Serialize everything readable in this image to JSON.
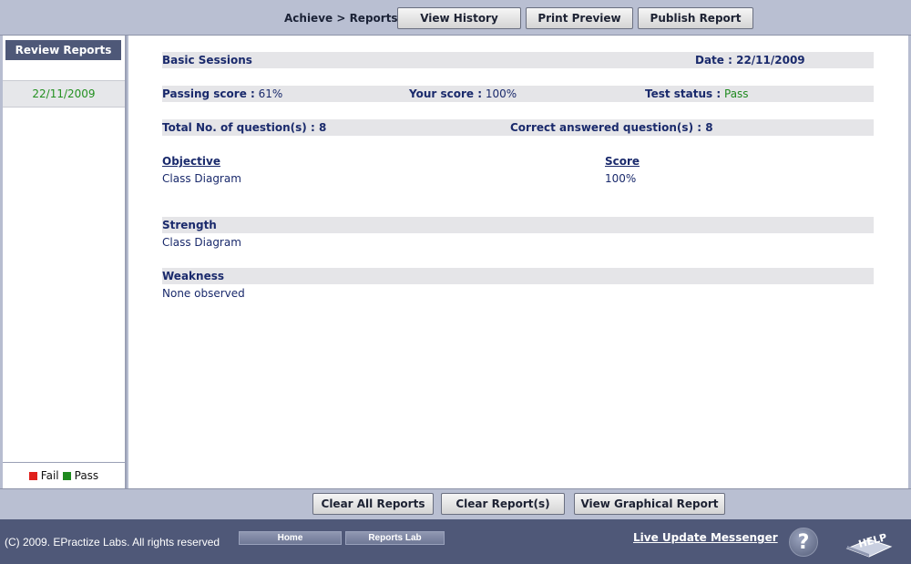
{
  "topbar": {
    "breadcrumb": "Achieve > Reports",
    "view_history": "View History",
    "print_preview": "Print Preview",
    "publish_report": "Publish Report"
  },
  "sidebar": {
    "header": "Review Reports",
    "date_item": "22/11/2009",
    "legend_fail": "Fail",
    "legend_pass": "Pass"
  },
  "report": {
    "session_name": "Basic Sessions",
    "date_label": "Date : 22/11/2009",
    "passing_score_label": "Passing score :",
    "passing_score_value": "61%",
    "your_score_label": "Your score :",
    "your_score_value": "100%",
    "test_status_label": "Test status :",
    "test_status_value": "Pass",
    "total_questions": "Total No. of question(s) : 8",
    "correct_answered": "Correct answered question(s) : 8",
    "objective_header": "Objective",
    "score_header": "Score",
    "objective_value": "Class Diagram",
    "score_value": "100%",
    "strength_header": "Strength",
    "strength_value": "Class Diagram",
    "weakness_header": "Weakness",
    "weakness_value": "None observed"
  },
  "bottombar": {
    "clear_all": "Clear All Reports",
    "clear_reports": "Clear Report(s)",
    "view_graphical": "View Graphical Report"
  },
  "footer": {
    "copyright": "(C) 2009. EPractize Labs. All rights reserved",
    "home": "Home",
    "reports_lab": "Reports Lab",
    "live_update": "Live Update Messenger",
    "help_glyph": "?",
    "help_text": "HELP"
  },
  "colors": {
    "fail": "#e0201c",
    "pass": "#1f8a1f",
    "header_navy": "#4e5878",
    "label_blue": "#1a2a6c"
  }
}
